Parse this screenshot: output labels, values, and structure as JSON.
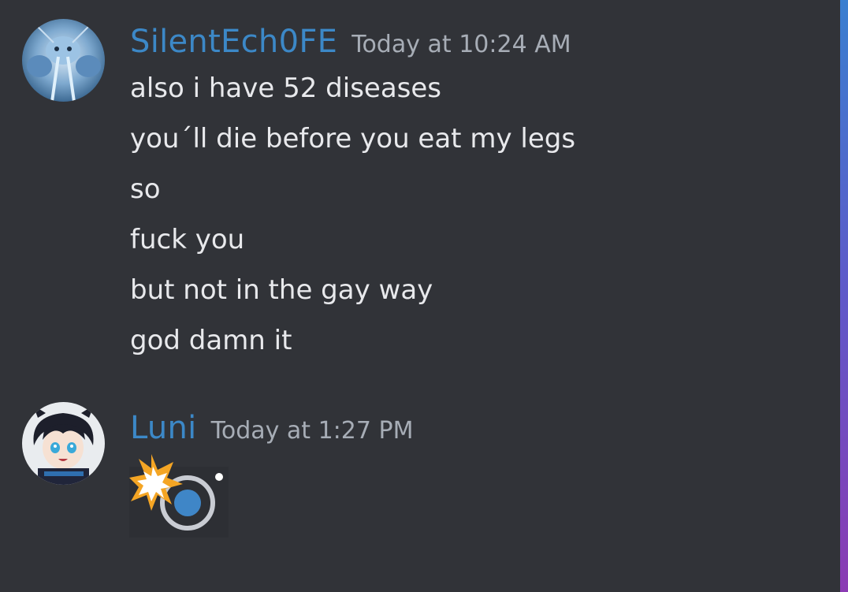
{
  "messages": [
    {
      "username": "SilentEch0FE",
      "timestamp": "Today at 10:24 AM",
      "lines": [
        "also i have 52 diseases",
        "you´ll die before you eat my legs",
        "so",
        "fuck you",
        "but not in the gay way",
        "god damn it"
      ]
    },
    {
      "username": "Luni",
      "timestamp": "Today at 1:27 PM",
      "sticker": "collision-emoji-with-ring-icon"
    }
  ],
  "colors": {
    "background": "#313338",
    "username": "#3c88c7",
    "timestamp": "#a7adb6",
    "text": "#e8e9ec",
    "scrollbar_top": "#3a7fd0",
    "scrollbar_bottom": "#8b3bb3"
  }
}
